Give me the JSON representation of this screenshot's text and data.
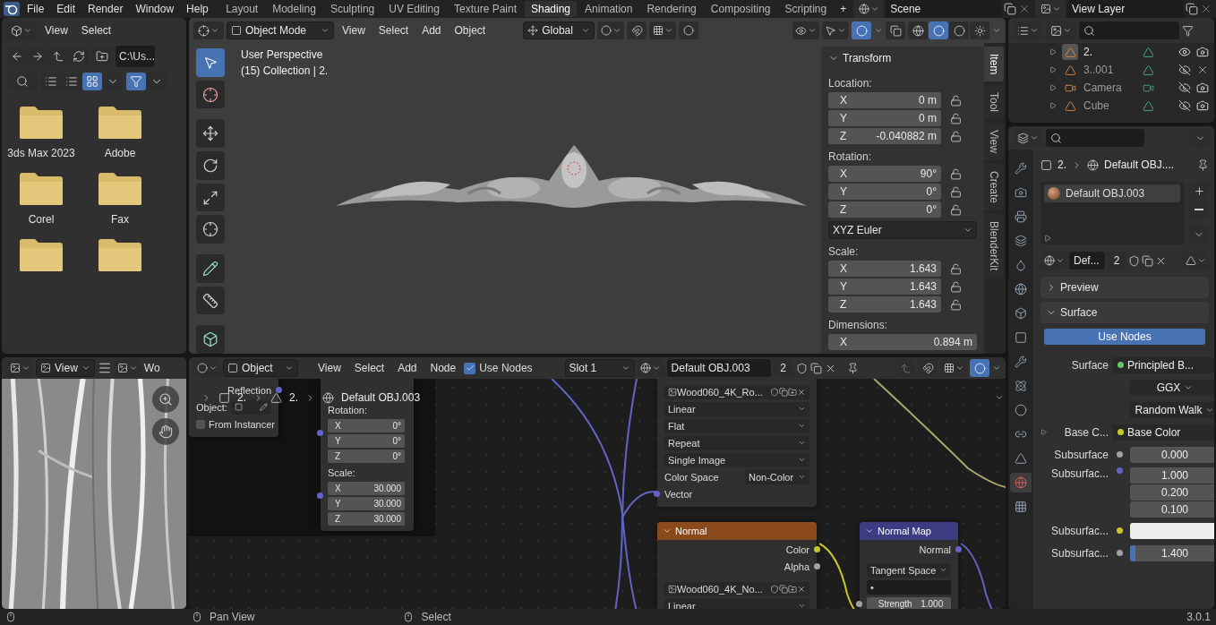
{
  "menu": [
    "File",
    "Edit",
    "Render",
    "Window",
    "Help"
  ],
  "workspaces": [
    {
      "label": "Layout",
      "selected": false
    },
    {
      "label": "Modeling",
      "selected": false
    },
    {
      "label": "Sculpting",
      "selected": false
    },
    {
      "label": "UV Editing",
      "selected": false
    },
    {
      "label": "Texture Paint",
      "selected": false
    },
    {
      "label": "Shading",
      "selected": true
    },
    {
      "label": "Animation",
      "selected": false
    },
    {
      "label": "Rendering",
      "selected": false
    },
    {
      "label": "Compositing",
      "selected": false
    },
    {
      "label": "Scripting",
      "selected": false
    }
  ],
  "add_workspace": "+",
  "scene": "Scene",
  "view_layer": "View Layer",
  "file_browser": {
    "menus": [
      "View",
      "Select"
    ],
    "path": "C:\\Us...",
    "folders": [
      {
        "kind": "named",
        "name": "3ds Max 2023"
      },
      {
        "kind": "named",
        "name": "Adobe"
      },
      {
        "kind": "named",
        "name": "Corel"
      },
      {
        "kind": "named",
        "name": "Fax"
      },
      {
        "kind": "cut"
      },
      {
        "kind": "cut"
      }
    ]
  },
  "viewport": {
    "mode": "Object Mode",
    "menus": [
      "View",
      "Select",
      "Add",
      "Object"
    ],
    "orientation": "Global",
    "info": [
      "User Perspective",
      "(15) Collection | 2."
    ],
    "sidebar": {
      "title": "Transform",
      "groups": [
        {
          "label": "Location:",
          "lockable": true,
          "fields": [
            {
              "axis": "X",
              "value": "0 m"
            },
            {
              "axis": "Y",
              "value": "0 m"
            },
            {
              "axis": "Z",
              "value": "-0.040882 m"
            }
          ]
        },
        {
          "label": "Rotation:",
          "lockable": true,
          "fields": [
            {
              "axis": "X",
              "value": "90°"
            },
            {
              "axis": "Y",
              "value": "0°"
            },
            {
              "axis": "Z",
              "value": "0°"
            }
          ],
          "mode": "XYZ Euler"
        },
        {
          "label": "Scale:",
          "lockable": true,
          "fields": [
            {
              "axis": "X",
              "value": "1.643"
            },
            {
              "axis": "Y",
              "value": "1.643"
            },
            {
              "axis": "Z",
              "value": "1.643"
            }
          ]
        },
        {
          "label": "Dimensions:",
          "lockable": false,
          "fields": [
            {
              "axis": "X",
              "value": "0.894 m"
            }
          ]
        }
      ],
      "tabs": [
        {
          "label": "Item",
          "selected": true
        },
        {
          "label": "Tool",
          "selected": false
        },
        {
          "label": "View",
          "selected": false
        },
        {
          "label": "Create",
          "selected": false
        },
        {
          "label": "BlenderKit",
          "selected": false
        }
      ]
    }
  },
  "outliner": {
    "items": [
      {
        "name": "2.",
        "kind": "mesh",
        "selected": true,
        "visible": true,
        "renderable": true
      },
      {
        "name": "3..001",
        "kind": "mesh",
        "selected": false,
        "visible": false,
        "renderable": false
      },
      {
        "name": "Camera",
        "kind": "camera",
        "selected": false,
        "visible": false,
        "renderable": true
      },
      {
        "name": "Cube",
        "kind": "mesh",
        "selected": false,
        "visible": false,
        "renderable": true
      }
    ]
  },
  "properties": {
    "breadcrumb": [
      "2.",
      "Default OBJ...."
    ],
    "tabs": [
      {
        "kind": "tool",
        "selected": false
      },
      {
        "kind": "render",
        "selected": false
      },
      {
        "kind": "output",
        "selected": false
      },
      {
        "kind": "view_layer",
        "selected": false
      },
      {
        "kind": "scene",
        "selected": false
      },
      {
        "kind": "world",
        "selected": false
      },
      {
        "kind": "collection",
        "selected": false
      },
      {
        "kind": "object",
        "selected": false
      },
      {
        "kind": "modifier",
        "selected": false
      },
      {
        "kind": "particles",
        "selected": false
      },
      {
        "kind": "physics",
        "selected": false
      },
      {
        "kind": "constraints",
        "selected": false
      },
      {
        "kind": "data",
        "selected": false
      },
      {
        "kind": "material",
        "selected": true
      },
      {
        "kind": "texture",
        "selected": false
      }
    ],
    "slots": [
      {
        "name": "Default OBJ.003",
        "selected": true
      }
    ],
    "material": {
      "name": "Def...",
      "users": "2"
    },
    "panels": [
      {
        "title": "Preview",
        "expanded": false
      },
      {
        "title": "Surface",
        "expanded": true
      }
    ],
    "use_nodes": "Use Nodes",
    "rows": [
      {
        "kind": "socket",
        "label": "Surface",
        "color": "#63c763",
        "value": "Principled B...",
        "expandable": false
      },
      {
        "kind": "dropdown",
        "value": "GGX"
      },
      {
        "kind": "dropdown",
        "value": "Random Walk"
      },
      {
        "kind": "socket",
        "label": "Base C...",
        "color": "#c7c729",
        "value": "Base Color",
        "expandable": true
      },
      {
        "kind": "number",
        "label": "Subsurface",
        "color": "#a1a1a1",
        "value": "0.000"
      },
      {
        "kind": "vector",
        "label": "Subsurfac...",
        "color": "#6363c7",
        "values": [
          "1.000",
          "0.200",
          "0.100"
        ]
      },
      {
        "kind": "color",
        "label": "Subsurfac...",
        "color": "#c7c729",
        "swatch": {
          "color": "#eeeeee"
        }
      },
      {
        "kind": "slider",
        "label": "Subsurfac...",
        "color": "#a1a1a1",
        "value": "1.400",
        "level": 0.06
      }
    ]
  },
  "image_editor": {
    "menus": [
      "View"
    ],
    "image_name": "Wo"
  },
  "node_editor": {
    "object_type": "Object",
    "menus": [
      "View",
      "Select",
      "Add",
      "Node"
    ],
    "use_nodes": {
      "label": "Use Nodes",
      "checked": true
    },
    "slot": "Slot 1",
    "material": "Default OBJ.003",
    "users": "2",
    "breadcrumb": [
      "2.",
      "2.",
      "Default OBJ.003"
    ],
    "texture_coordinate": {
      "output": "Reflection",
      "object_label": "Object:",
      "from_instancer": {
        "label": "From Instancer",
        "checked": false
      }
    },
    "mapping": {
      "groups": [
        {
          "label": "Rotation:",
          "fields": [
            {
              "axis": "X",
              "value": "0°"
            },
            {
              "axis": "Y",
              "value": "0°"
            },
            {
              "axis": "Z",
              "value": "0°"
            }
          ]
        },
        {
          "label": "Scale:",
          "fields": [
            {
              "axis": "X",
              "value": "30.000"
            },
            {
              "axis": "Y",
              "value": "30.000"
            },
            {
              "axis": "Z",
              "value": "30.000"
            }
          ]
        }
      ]
    },
    "texture": {
      "image": "Wood060_4K_Ro...",
      "options": [
        "Linear",
        "Flat",
        "Repeat",
        "Single Image"
      ],
      "color_space_label": "Color Space",
      "color_space": "Non-Color",
      "input": "Vector"
    },
    "normal_node": {
      "title": "Normal",
      "outputs": [
        "Color",
        "Alpha"
      ],
      "image": "Wood060_4K_No...",
      "options": [
        "Linear"
      ]
    },
    "normal_map": {
      "title": "Normal Map",
      "output": "Normal",
      "space": "Tangent Space",
      "uv_map": "•",
      "strength_label": "Strength",
      "strength": "1.000"
    }
  },
  "status_bar": {
    "items": [
      "Pan View",
      "Select"
    ],
    "version": "3.0.1"
  }
}
